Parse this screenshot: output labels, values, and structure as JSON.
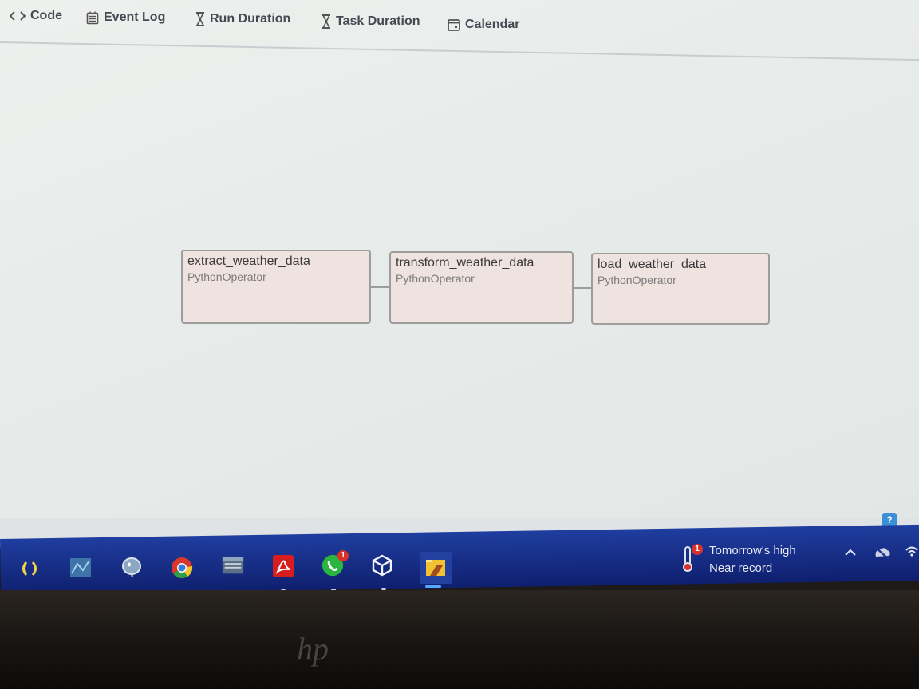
{
  "nav": {
    "items": [
      {
        "label": "Code",
        "icon": "code-icon"
      },
      {
        "label": "Event Log",
        "icon": "event-log-icon"
      },
      {
        "label": "Run Duration",
        "icon": "hourglass-icon"
      },
      {
        "label": "Task Duration",
        "icon": "hourglass-icon"
      },
      {
        "label": "Calendar",
        "icon": "calendar-icon"
      }
    ]
  },
  "graph": {
    "nodes": [
      {
        "task_id": "extract_weather_data",
        "operator": "PythonOperator"
      },
      {
        "task_id": "transform_weather_data",
        "operator": "PythonOperator"
      },
      {
        "task_id": "load_weather_data",
        "operator": "PythonOperator"
      }
    ]
  },
  "taskbar": {
    "apps": [
      "sync-app-icon",
      "network-tool-icon",
      "postgresql-icon",
      "chrome-icon",
      "keyboard-app-icon",
      "acrobat-icon",
      "whatsapp-icon",
      "virtualbox-icon",
      "file-manager-icon"
    ],
    "whatsapp_badge": "1",
    "weather": {
      "badge": "1",
      "line1": "Tomorrow's high",
      "line2": "Near record"
    }
  },
  "colors": {
    "taskbar": "#1a3490",
    "node_fill": "#efe3df",
    "node_border": "#9d9d9d",
    "nav_text": "#444a52"
  }
}
